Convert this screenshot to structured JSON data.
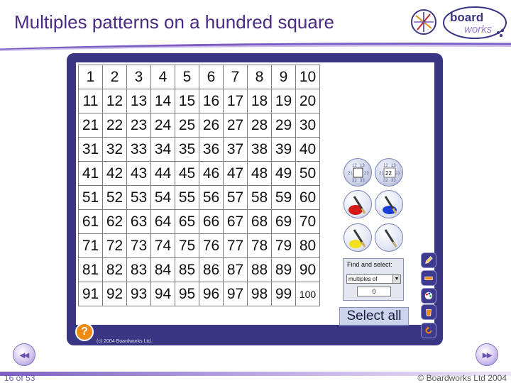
{
  "slide": {
    "title": "Multiples patterns on a hundred square",
    "page_indicator": "16 of 53",
    "footer_copyright": "© Boardworks Ltd 2004",
    "logo_text_top": "board",
    "logo_text_bottom": "works"
  },
  "hundred_square": {
    "rows": [
      [
        "1",
        "2",
        "3",
        "4",
        "5",
        "6",
        "7",
        "8",
        "9",
        "10"
      ],
      [
        "11",
        "12",
        "13",
        "14",
        "15",
        "16",
        "17",
        "18",
        "19",
        "20"
      ],
      [
        "21",
        "22",
        "23",
        "24",
        "25",
        "26",
        "27",
        "28",
        "29",
        "30"
      ],
      [
        "31",
        "32",
        "33",
        "34",
        "35",
        "36",
        "37",
        "38",
        "39",
        "40"
      ],
      [
        "41",
        "42",
        "43",
        "44",
        "45",
        "46",
        "47",
        "48",
        "49",
        "50"
      ],
      [
        "51",
        "52",
        "53",
        "54",
        "55",
        "56",
        "57",
        "58",
        "59",
        "60"
      ],
      [
        "61",
        "62",
        "63",
        "64",
        "65",
        "66",
        "67",
        "68",
        "69",
        "70"
      ],
      [
        "71",
        "72",
        "73",
        "74",
        "75",
        "76",
        "77",
        "78",
        "79",
        "80"
      ],
      [
        "81",
        "82",
        "83",
        "84",
        "85",
        "86",
        "87",
        "88",
        "89",
        "90"
      ],
      [
        "91",
        "92",
        "93",
        "94",
        "95",
        "96",
        "97",
        "98",
        "99",
        "100"
      ]
    ]
  },
  "tools": {
    "hide_numbers_preview": [
      "12",
      "13",
      "22",
      "23",
      "32",
      "33"
    ],
    "show_numbers_preview": [
      "12",
      "13",
      "22",
      "23",
      "32",
      "33"
    ],
    "paint_colors": [
      "#d41919",
      "#1a3fd9",
      "#f2e01c",
      "#ffffff"
    ]
  },
  "find_panel": {
    "label": "Find and select:",
    "mode_value": "multiples of",
    "number_value": "0"
  },
  "select_all_label": "Select all",
  "panel_copyright": "(c) 2004 Boardworks Ltd.",
  "help_label": "?",
  "colors": {
    "panel": "#3b3683",
    "title": "#4b2a86"
  }
}
